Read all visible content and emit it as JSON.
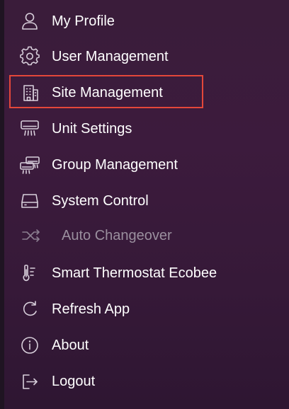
{
  "menu": {
    "items": [
      {
        "label": "My Profile",
        "icon": "person-icon",
        "enabled": true
      },
      {
        "label": "User Management",
        "icon": "gear-icon",
        "enabled": true
      },
      {
        "label": "Site Management",
        "icon": "building-icon",
        "enabled": true,
        "selected": true
      },
      {
        "label": "Unit Settings",
        "icon": "air-conditioner-icon",
        "enabled": true
      },
      {
        "label": "Group Management",
        "icon": "group-units-icon",
        "enabled": true
      },
      {
        "label": "System Control",
        "icon": "hard-drive-icon",
        "enabled": true
      },
      {
        "label": "Auto Changeover",
        "icon": "shuffle-icon",
        "enabled": false
      },
      {
        "label": "Smart Thermostat Ecobee",
        "icon": "thermometer-icon",
        "enabled": true
      },
      {
        "label": "Refresh App",
        "icon": "refresh-icon",
        "enabled": true
      },
      {
        "label": "About",
        "icon": "info-icon",
        "enabled": true
      },
      {
        "label": "Logout",
        "icon": "logout-icon",
        "enabled": true
      }
    ]
  },
  "colors": {
    "background": "#3a1c3a",
    "text": "#ffffff",
    "disabled_text": "#9a8f9e",
    "selection_border": "#e4473a"
  }
}
